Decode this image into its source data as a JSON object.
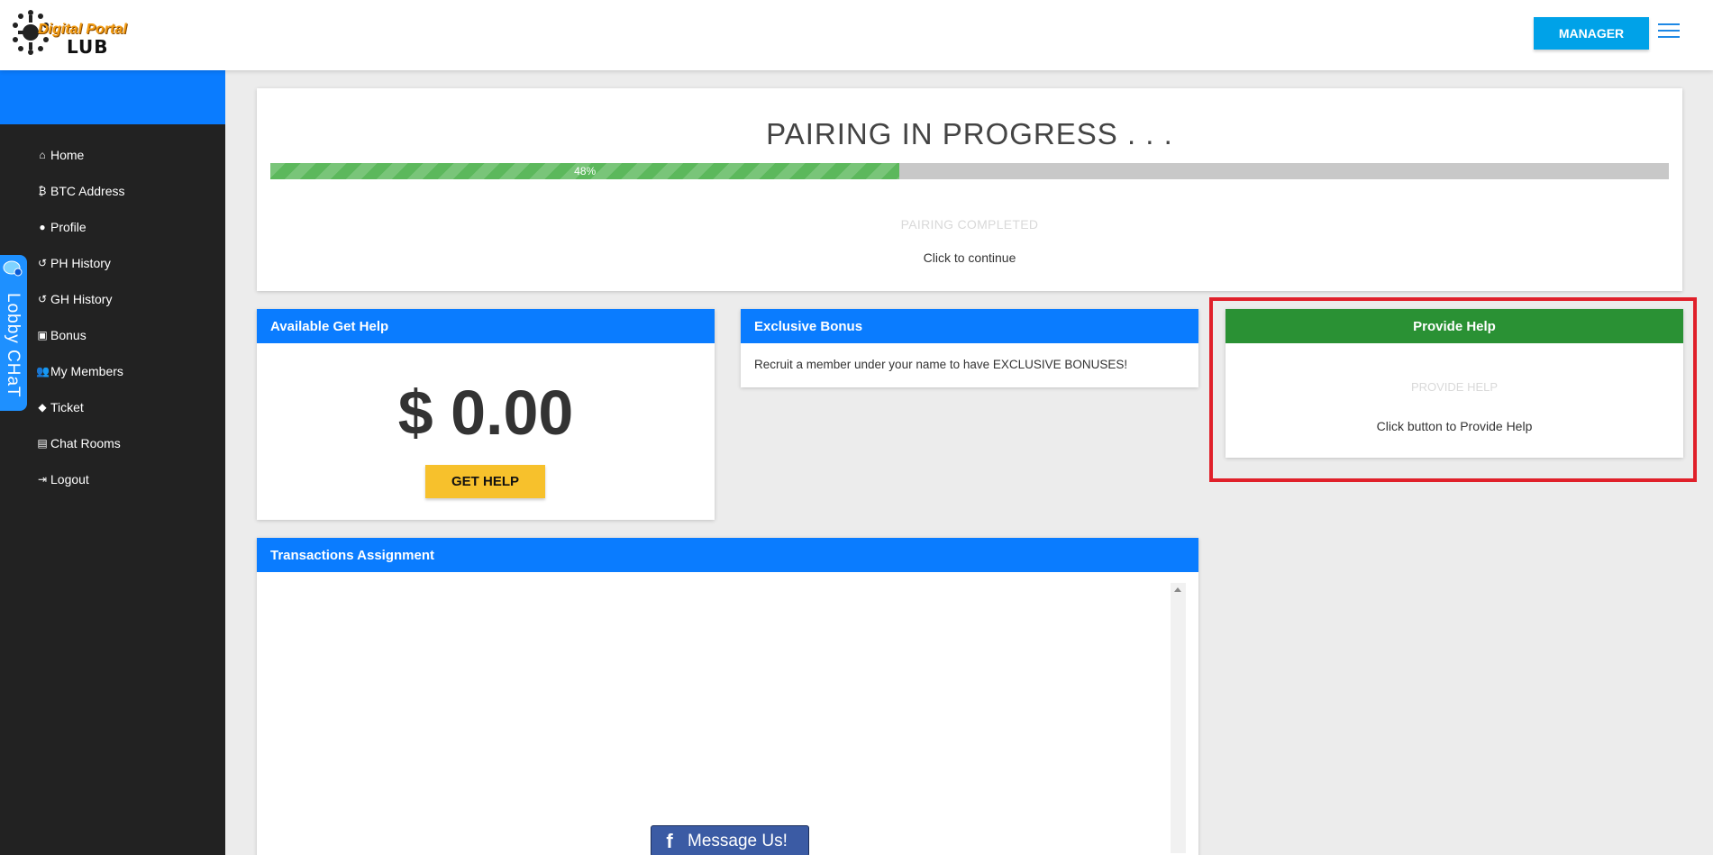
{
  "brand": {
    "line1": "Digital Portal",
    "line2": "LUB"
  },
  "header": {
    "manager_label": "MANAGER"
  },
  "sidebar": {
    "items": [
      {
        "icon": "home-icon",
        "glyph": "⌂",
        "label": "Home"
      },
      {
        "icon": "bitcoin-icon",
        "glyph": "₿",
        "label": "BTC Address"
      },
      {
        "icon": "user-icon",
        "glyph": "●",
        "label": "Profile"
      },
      {
        "icon": "history-icon",
        "glyph": "↺",
        "label": "PH History"
      },
      {
        "icon": "history-icon",
        "glyph": "↺",
        "label": "GH History"
      },
      {
        "icon": "money-icon",
        "glyph": "▣",
        "label": "Bonus"
      },
      {
        "icon": "users-icon",
        "glyph": "👥",
        "label": "My Members"
      },
      {
        "icon": "ticket-icon",
        "glyph": "◆",
        "label": "Ticket"
      },
      {
        "icon": "inbox-icon",
        "glyph": "▤",
        "label": "Chat Rooms"
      },
      {
        "icon": "logout-icon",
        "glyph": "⇥",
        "label": "Logout"
      }
    ]
  },
  "lobby_chat": {
    "label": "Lobby CHaT"
  },
  "pairing": {
    "title": "PAIRING IN PROGRESS . . .",
    "progress_label": "48%",
    "progress_percent": 45,
    "completed_label": "PAIRING COMPLETED",
    "continue_text": "Click to continue"
  },
  "available": {
    "title": "Available Get Help",
    "amount": "$ 0.00",
    "button_label": "GET HELP"
  },
  "bonus": {
    "title": "Exclusive Bonus",
    "text": "Recruit a member under your name to have EXCLUSIVE BONUSES!"
  },
  "provide": {
    "title": "Provide Help",
    "button_label": "PROVIDE HELP",
    "subtitle": "Click button to Provide Help"
  },
  "transactions": {
    "title": "Transactions Assignment"
  },
  "messenger": {
    "label": "Message Us!"
  },
  "colors": {
    "primary": "#0a7cff",
    "sidebar": "#222222",
    "success": "#2a9134",
    "progress": "#5cb85c",
    "highlight": "#e0202a"
  }
}
